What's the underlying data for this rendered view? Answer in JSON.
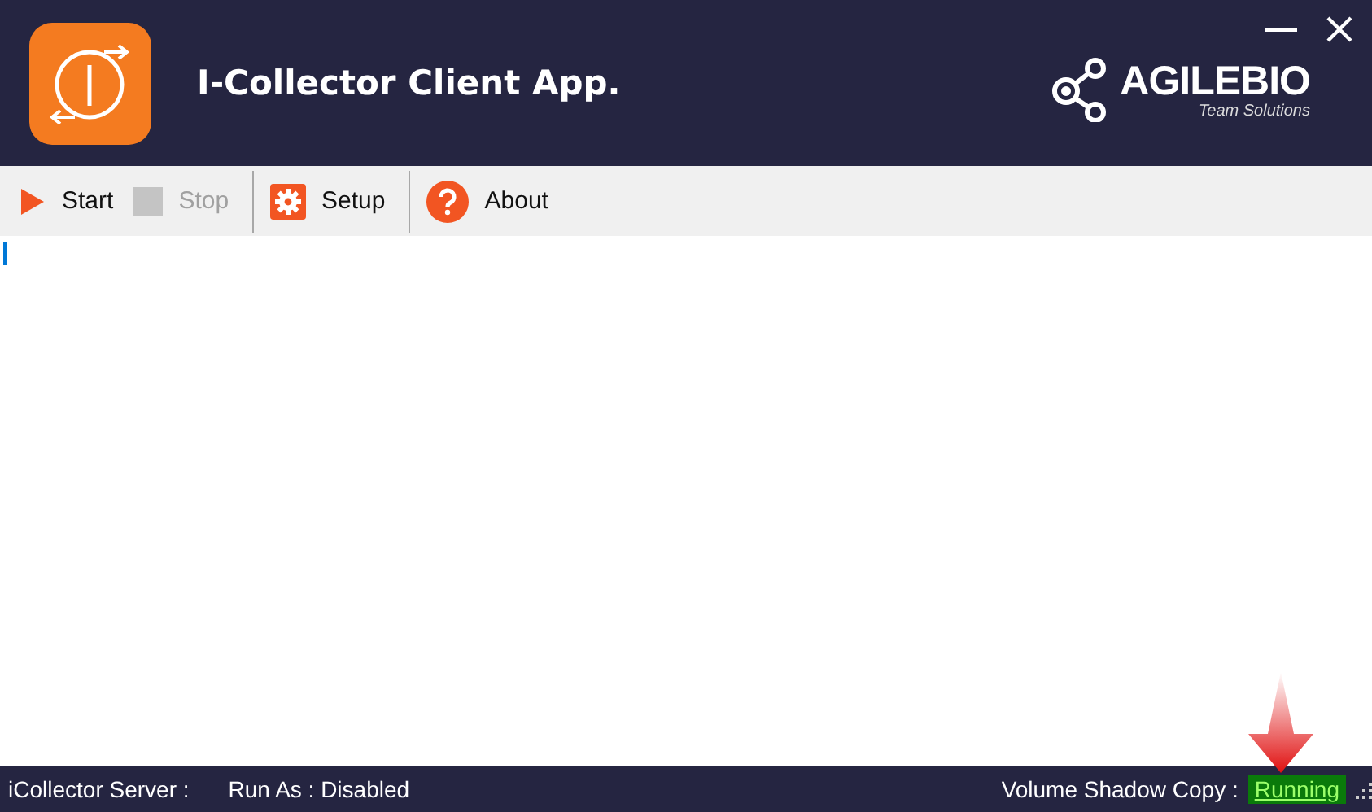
{
  "window": {
    "title": "I-Collector Client App."
  },
  "brand": {
    "name": "AGILEBIO",
    "tagline": "Team Solutions"
  },
  "toolbar": [
    {
      "label": "Start",
      "kind": "play",
      "disabled": false
    },
    {
      "label": "Stop",
      "kind": "stop",
      "disabled": true
    },
    {
      "label": "Setup",
      "kind": "gear",
      "disabled": false
    },
    {
      "label": "About",
      "kind": "help",
      "disabled": false
    }
  ],
  "status_bar": {
    "server": "iCollector Server :",
    "run_as": "Run As : Disabled",
    "vss_label": "Volume Shadow Copy :",
    "vss_status": "Running",
    "vss_running": true
  }
}
